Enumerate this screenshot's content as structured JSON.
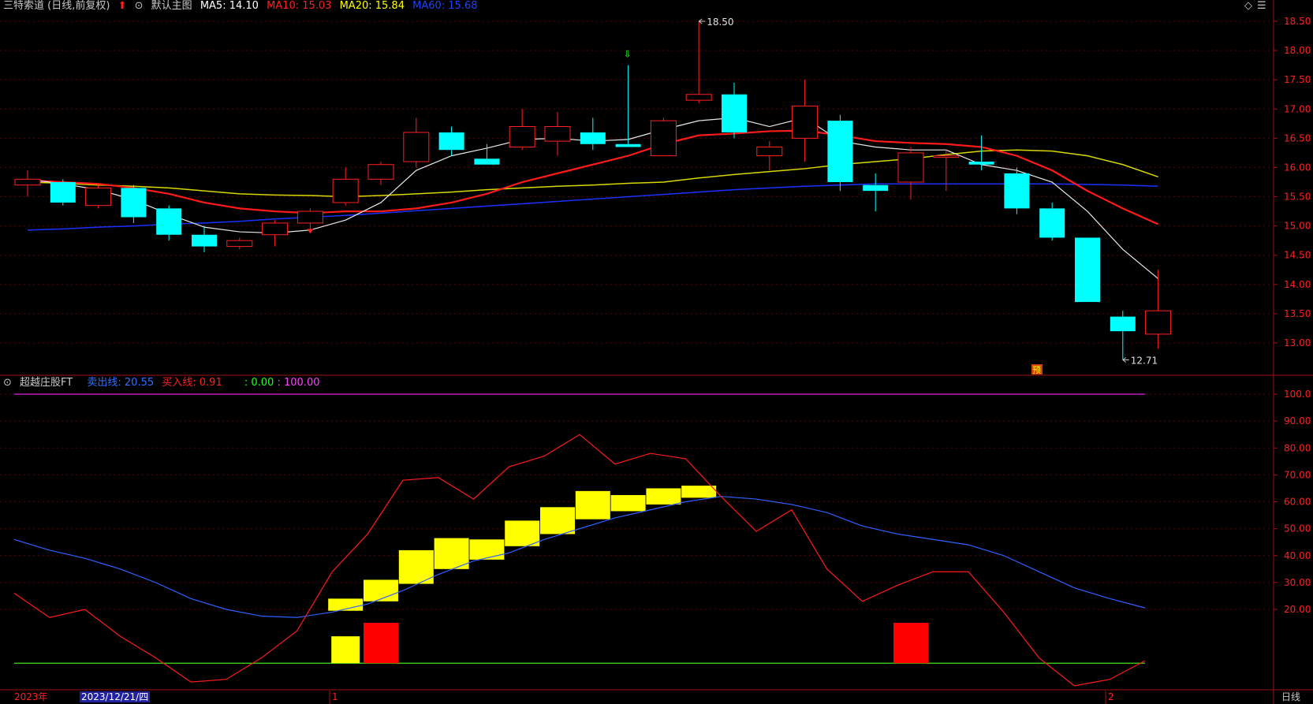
{
  "top_header": {
    "stock_name": "三特索道 (日线,前复权)",
    "view_name": "默认主图",
    "ma5": "MA5: 14.10",
    "ma10": "MA10: 15.03",
    "ma20": "MA20: 15.84",
    "ma60": "MA60: 15.68",
    "colors": {
      "ma5": "#ffffff",
      "ma10": "#ff2020",
      "ma20": "#ffff00",
      "ma60": "#2040ff"
    }
  },
  "bottom_header": {
    "indicator_name": "超越庄股FT",
    "sell_line": "卖出线: 20.55",
    "buy_line": "买入线: 0.91",
    "zero": ": 0.00",
    "hundred": ": 100.00"
  },
  "price_axis": {
    "ticks": [
      "18.50",
      "18.00",
      "17.50",
      "17.00",
      "16.50",
      "16.00",
      "15.50",
      "15.00",
      "14.50",
      "14.00",
      "13.50",
      "13.00"
    ]
  },
  "indicator_axis": {
    "ticks": [
      "100.0",
      "90.00",
      "80.00",
      "70.00",
      "60.00",
      "50.00",
      "40.00",
      "30.00",
      "20.00"
    ]
  },
  "annotations": {
    "high_label": "18.50",
    "low_label": "12.71",
    "pre_badge": "预"
  },
  "date_bar": {
    "year": "2023年",
    "cursor_date": "2023/12/21/四",
    "month_1": "1",
    "month_2": "2",
    "period": "日线"
  },
  "chart_data": {
    "type": "candlestick",
    "price_range": [
      12.5,
      18.8
    ],
    "candles": [
      {
        "o": 15.7,
        "h": 15.95,
        "l": 15.5,
        "c": 15.8
      },
      {
        "o": 15.75,
        "h": 15.8,
        "l": 15.35,
        "c": 15.4
      },
      {
        "o": 15.35,
        "h": 15.7,
        "l": 15.3,
        "c": 15.65
      },
      {
        "o": 15.65,
        "h": 15.7,
        "l": 15.05,
        "c": 15.15
      },
      {
        "o": 15.3,
        "h": 15.35,
        "l": 14.75,
        "c": 14.85
      },
      {
        "o": 14.85,
        "h": 15.0,
        "l": 14.55,
        "c": 14.65
      },
      {
        "o": 14.65,
        "h": 14.8,
        "l": 14.6,
        "c": 14.75
      },
      {
        "o": 14.85,
        "h": 15.1,
        "l": 14.65,
        "c": 15.05
      },
      {
        "o": 15.05,
        "h": 15.3,
        "l": 14.9,
        "c": 15.25
      },
      {
        "o": 15.4,
        "h": 16.0,
        "l": 15.35,
        "c": 15.8
      },
      {
        "o": 15.8,
        "h": 16.1,
        "l": 15.7,
        "c": 16.05
      },
      {
        "o": 16.1,
        "h": 16.85,
        "l": 16.0,
        "c": 16.6
      },
      {
        "o": 16.6,
        "h": 16.7,
        "l": 16.2,
        "c": 16.3
      },
      {
        "o": 16.15,
        "h": 16.4,
        "l": 16.05,
        "c": 16.05
      },
      {
        "o": 16.35,
        "h": 17.0,
        "l": 16.3,
        "c": 16.7
      },
      {
        "o": 16.45,
        "h": 16.95,
        "l": 16.2,
        "c": 16.7
      },
      {
        "o": 16.6,
        "h": 16.85,
        "l": 16.3,
        "c": 16.4
      },
      {
        "o": 16.4,
        "h": 17.75,
        "l": 16.35,
        "c": 16.35
      },
      {
        "o": 16.2,
        "h": 16.85,
        "l": 16.2,
        "c": 16.8
      },
      {
        "o": 17.15,
        "h": 18.5,
        "l": 17.1,
        "c": 17.25
      },
      {
        "o": 17.25,
        "h": 17.45,
        "l": 16.5,
        "c": 16.6
      },
      {
        "o": 16.2,
        "h": 16.45,
        "l": 15.95,
        "c": 16.35
      },
      {
        "o": 16.5,
        "h": 17.5,
        "l": 16.1,
        "c": 17.05
      },
      {
        "o": 16.8,
        "h": 16.9,
        "l": 15.6,
        "c": 15.75
      },
      {
        "o": 15.7,
        "h": 15.9,
        "l": 15.25,
        "c": 15.6
      },
      {
        "o": 15.75,
        "h": 16.35,
        "l": 15.45,
        "c": 16.25
      },
      {
        "o": 16.2,
        "h": 16.3,
        "l": 15.6,
        "c": 16.2
      },
      {
        "o": 16.1,
        "h": 16.55,
        "l": 15.95,
        "c": 16.05
      },
      {
        "o": 15.9,
        "h": 16.0,
        "l": 15.2,
        "c": 15.3
      },
      {
        "o": 15.3,
        "h": 15.4,
        "l": 14.75,
        "c": 14.8
      },
      {
        "o": 14.8,
        "h": 14.8,
        "l": 13.7,
        "c": 13.7
      },
      {
        "o": 13.45,
        "h": 13.55,
        "l": 12.71,
        "c": 13.2
      },
      {
        "o": 13.15,
        "h": 14.25,
        "l": 12.9,
        "c": 13.55
      }
    ],
    "ma5": [
      15.8,
      15.72,
      15.62,
      15.45,
      15.2,
      14.98,
      14.9,
      14.88,
      14.93,
      15.1,
      15.4,
      15.95,
      16.2,
      16.33,
      16.48,
      16.5,
      16.45,
      16.48,
      16.65,
      16.8,
      16.85,
      16.7,
      16.85,
      16.45,
      16.35,
      16.3,
      16.3,
      16.05,
      15.95,
      15.75,
      15.25,
      14.6,
      14.1
    ],
    "ma10": [
      15.78,
      15.75,
      15.72,
      15.65,
      15.55,
      15.4,
      15.3,
      15.25,
      15.22,
      15.25,
      15.25,
      15.3,
      15.4,
      15.55,
      15.75,
      15.9,
      16.05,
      16.2,
      16.4,
      16.55,
      16.58,
      16.62,
      16.63,
      16.55,
      16.45,
      16.42,
      16.4,
      16.35,
      16.2,
      15.95,
      15.6,
      15.3,
      15.03
    ],
    "ma20": [
      15.75,
      15.73,
      15.7,
      15.68,
      15.65,
      15.6,
      15.55,
      15.53,
      15.52,
      15.5,
      15.52,
      15.55,
      15.58,
      15.62,
      15.65,
      15.68,
      15.7,
      15.73,
      15.75,
      15.82,
      15.88,
      15.93,
      15.98,
      16.05,
      16.1,
      16.15,
      16.22,
      16.28,
      16.3,
      16.28,
      16.2,
      16.05,
      15.84
    ],
    "ma60": [
      14.93,
      14.95,
      14.98,
      15.0,
      15.03,
      15.05,
      15.08,
      15.12,
      15.15,
      15.18,
      15.22,
      15.26,
      15.3,
      15.34,
      15.38,
      15.42,
      15.46,
      15.5,
      15.54,
      15.58,
      15.62,
      15.65,
      15.68,
      15.7,
      15.72,
      15.72,
      15.72,
      15.72,
      15.72,
      15.72,
      15.71,
      15.7,
      15.68
    ],
    "indicator": {
      "range": [
        0,
        105
      ],
      "sell_line": [
        46,
        42,
        39,
        35,
        30,
        24,
        20,
        17.5,
        17,
        19,
        22,
        27,
        33,
        38,
        41,
        46,
        50,
        54,
        57,
        60,
        62,
        61,
        59,
        56,
        51,
        48,
        46,
        44,
        40,
        34,
        28,
        24,
        20.55
      ],
      "buy_line": [
        26,
        17,
        20,
        10,
        2,
        -7,
        -6,
        2,
        12,
        34,
        48,
        68,
        69,
        61,
        73,
        77,
        85,
        74,
        78,
        76,
        62,
        49,
        57,
        35,
        23,
        29,
        34,
        34,
        19,
        2,
        -10,
        -6,
        0.91
      ],
      "yellow_bars": [
        {
          "index": 9,
          "low": 19.5,
          "high": 24
        },
        {
          "index": 10,
          "low": 23,
          "high": 31
        },
        {
          "index": 11,
          "low": 29.5,
          "high": 42
        },
        {
          "index": 12,
          "low": 35,
          "high": 46.5
        },
        {
          "index": 13,
          "low": 38.5,
          "high": 46
        },
        {
          "index": 14,
          "low": 43.5,
          "high": 53
        },
        {
          "index": 15,
          "low": 48,
          "high": 58
        },
        {
          "index": 16,
          "low": 53.5,
          "high": 64
        },
        {
          "index": 17,
          "low": 56.5,
          "high": 62.5
        },
        {
          "index": 18,
          "low": 59,
          "high": 65
        },
        {
          "index": 19,
          "low": 61.5,
          "high": 66
        }
      ],
      "bottom_signals": [
        {
          "index": 9,
          "color": "#ffff00",
          "low": 0,
          "high": 10
        },
        {
          "index": 10,
          "color": "#ff0000",
          "low": 0,
          "high": 15
        },
        {
          "index": 25,
          "color": "#ff0000",
          "low": 0,
          "high": 15
        }
      ]
    }
  }
}
